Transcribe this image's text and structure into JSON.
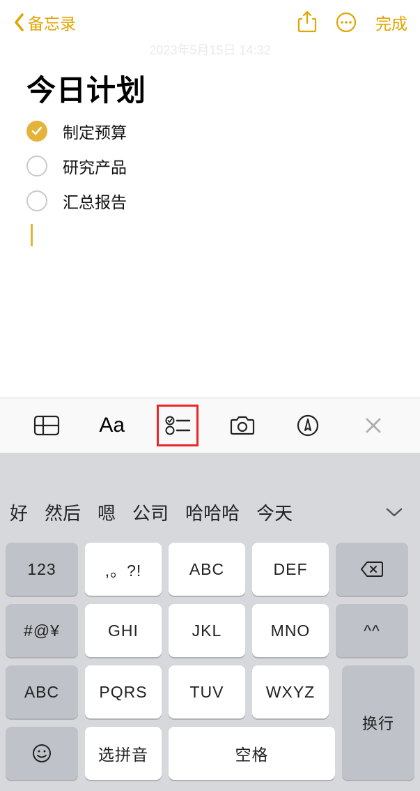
{
  "header": {
    "back_label": "备忘录",
    "done_label": "完成"
  },
  "timestamp": "2023年5月15日 14:32",
  "note": {
    "title": "今日计划",
    "items": [
      {
        "label": "制定预算",
        "checked": true
      },
      {
        "label": "研究产品",
        "checked": false
      },
      {
        "label": "汇总报告",
        "checked": false
      }
    ]
  },
  "toolbar": {
    "aa_label": "Aa"
  },
  "suggestions": [
    "好",
    "然后",
    "嗯",
    "公司",
    "哈哈哈",
    "今天"
  ],
  "keyboard": {
    "k123": "123",
    "punct": ",。?!",
    "abc": "ABC",
    "def": "DEF",
    "sym": "#@¥",
    "ghi": "GHI",
    "jkl": "JKL",
    "mno": "MNO",
    "kaomoji": "^^",
    "abc_mode": "ABC",
    "pqrs": "PQRS",
    "tuv": "TUV",
    "wxyz": "WXYZ",
    "pinyin": "选拼音",
    "space": "空格",
    "enter": "换行"
  }
}
